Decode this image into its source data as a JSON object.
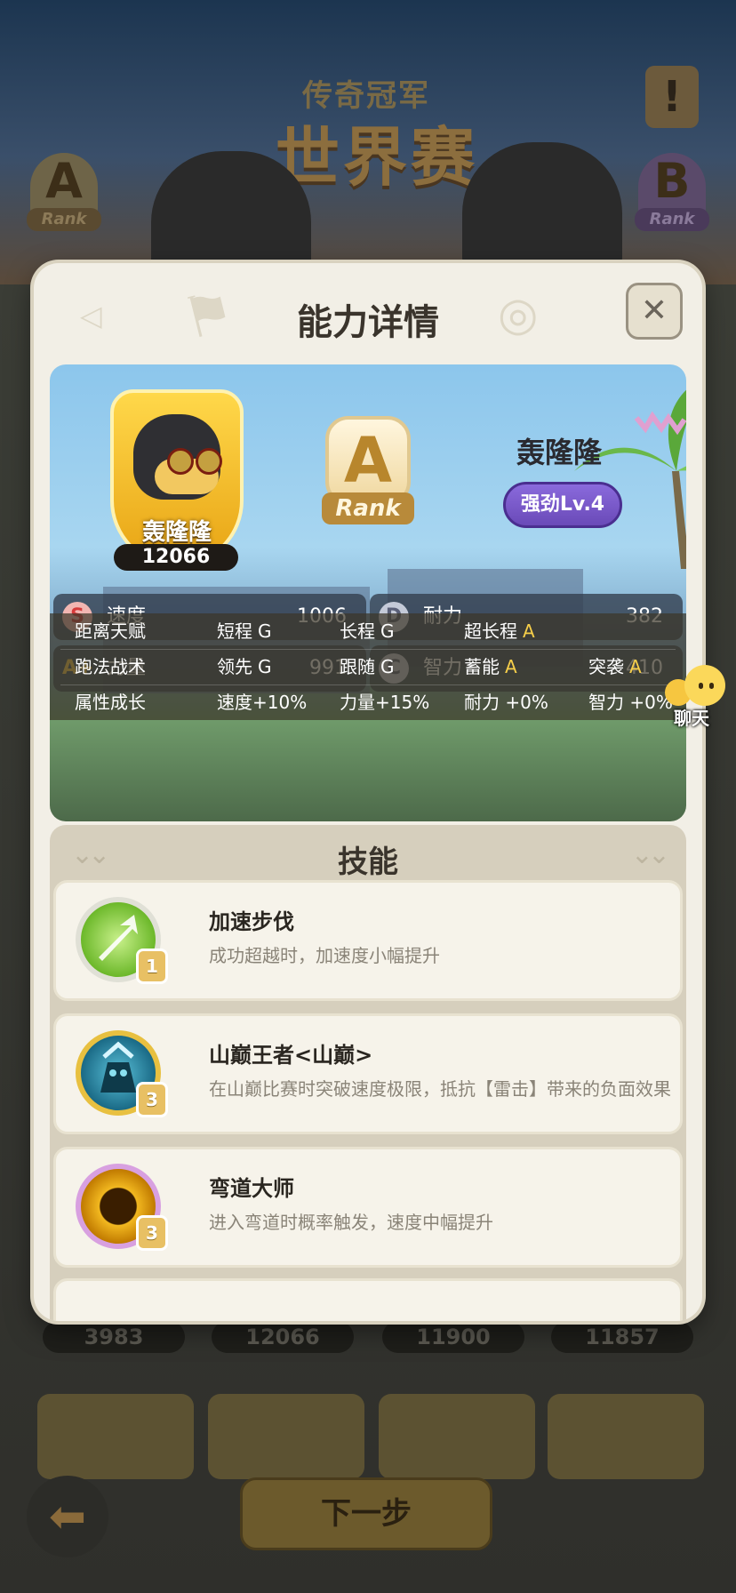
{
  "background": {
    "event_title_top": "传奇冠军",
    "event_title_main": "世界赛",
    "rank_left": {
      "letter": "A",
      "label": "Rank"
    },
    "rank_right": {
      "letter": "B",
      "label": "Rank"
    },
    "bottom_scores": [
      "3983",
      "12066",
      "11900",
      "11857"
    ],
    "next_button_label": "下一步",
    "chat_label": "聊天"
  },
  "modal": {
    "title": "能力详情",
    "close_label": "✕"
  },
  "character": {
    "name": "轰隆隆",
    "score": "12066",
    "rank_letter": "A",
    "rank_label": "Rank",
    "display_name": "轰隆隆",
    "level_label": "强劲Lv.4"
  },
  "stats": [
    {
      "grade": "S",
      "name": "速度",
      "value": "1006"
    },
    {
      "grade": "D",
      "name": "耐力",
      "value": "382"
    },
    {
      "grade": "A+",
      "name": "力量",
      "value": "991"
    },
    {
      "grade": "C",
      "name": "智力",
      "value": "410"
    }
  ],
  "traits": [
    {
      "label": "距离天赋",
      "items": [
        {
          "name": "短程",
          "grade": "G"
        },
        {
          "name": "长程",
          "grade": "G"
        },
        {
          "name": "超长程",
          "grade": "A"
        }
      ]
    },
    {
      "label": "跑法战术",
      "items": [
        {
          "name": "领先",
          "grade": "G"
        },
        {
          "name": "跟随",
          "grade": "G"
        },
        {
          "name": "蓄能",
          "grade": "A"
        },
        {
          "name": "突袭",
          "grade": "A"
        }
      ]
    },
    {
      "label": "属性成长",
      "items": [
        {
          "name": "速度",
          "grade": "+10%"
        },
        {
          "name": "力量",
          "grade": "+15%"
        },
        {
          "name": "耐力",
          "grade": "+0%"
        },
        {
          "name": "智力",
          "grade": "+0%"
        }
      ]
    }
  ],
  "skills_title": "技能",
  "skills": [
    {
      "name": "加速步伐",
      "desc": "成功超越时，加速度小幅提升",
      "level": "1",
      "icon": "speed-arrow-icon",
      "color": "#8ccf3a"
    },
    {
      "name": "山巅王者<山巅>",
      "desc": "在山巅比赛时突破速度极限，抵抗【雷击】带来的负面效果",
      "level": "3",
      "icon": "mountain-king-icon",
      "color": "#2a8aa6"
    },
    {
      "name": "弯道大师",
      "desc": "进入弯道时概率触发，速度中幅提升",
      "level": "3",
      "icon": "curve-ring-icon",
      "color": "#e0a010"
    }
  ]
}
